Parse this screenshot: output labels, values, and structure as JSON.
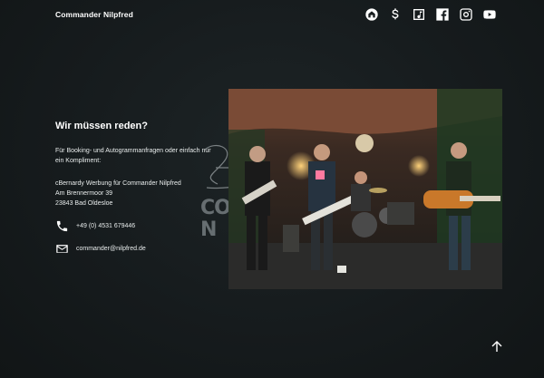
{
  "header": {
    "brand": "Commander Nilpfred",
    "icons": [
      "home-icon",
      "dollar-icon",
      "music-note-icon",
      "facebook-icon",
      "instagram-icon",
      "youtube-icon"
    ]
  },
  "main": {
    "heading": "Wir müssen reden?",
    "intro": "Für Booking- und Autogrammanfragen oder einfach nur ein Kompliment:",
    "address_line1": "cBernardy Werbung für Commander Nilpfred",
    "address_line2": "Am Brennermoor 39",
    "address_line3": "23843 Bad Oldesloe",
    "phone": "+49 (0) 4531 679446",
    "email": "commander@nilpfred.de"
  },
  "watermark": {
    "line1": "CO",
    "line2": "N"
  },
  "colors": {
    "background": "#161b1d",
    "text": "#ffffff"
  }
}
